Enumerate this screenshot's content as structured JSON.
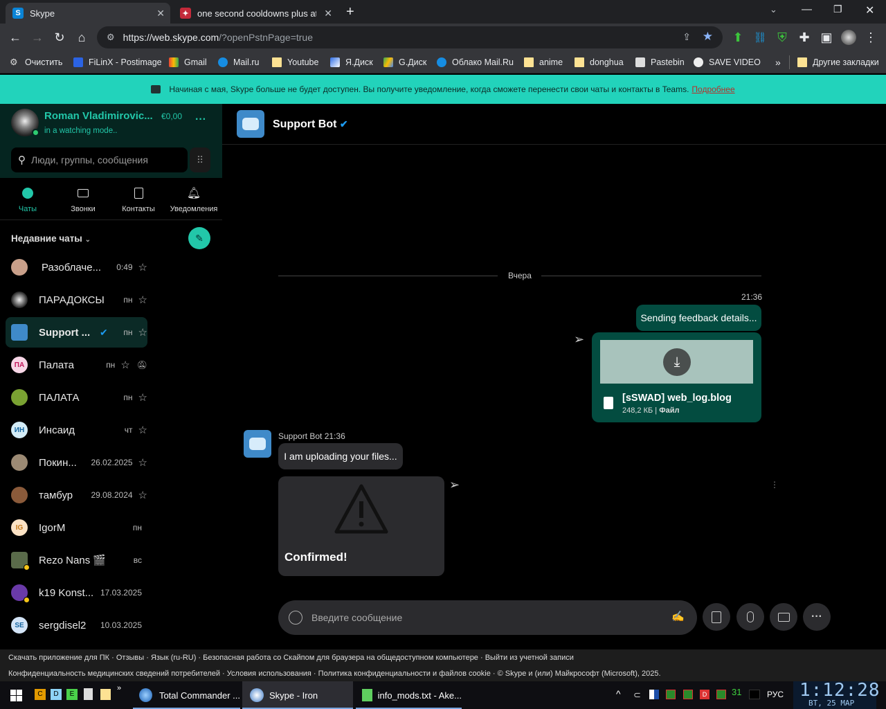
{
  "browser": {
    "tabs": [
      {
        "title": "Skype",
        "active": true
      },
      {
        "title": "one second cooldowns plus at D",
        "active": false
      }
    ],
    "new_tab_icon": "plus-icon",
    "url_host": "https://web.skype.com",
    "url_rest": "/?openPstnPage=true",
    "bookmarks": [
      {
        "label": "Очистить",
        "icon": "gear-icon"
      },
      {
        "label": "FiLinX - Postimage",
        "icon": "postimage-icon"
      },
      {
        "label": "Gmail",
        "icon": "gmail-icon"
      },
      {
        "label": "Mail.ru",
        "icon": "at-icon"
      },
      {
        "label": "Youtube",
        "icon": "folder-icon"
      },
      {
        "label": "Я.Диск",
        "icon": "yadisk-icon"
      },
      {
        "label": "G.Диск",
        "icon": "gdrive-icon"
      },
      {
        "label": "Облако Mail.Ru",
        "icon": "cloud-icon"
      },
      {
        "label": "anime",
        "icon": "folder-icon"
      },
      {
        "label": "donghua",
        "icon": "folder-icon"
      },
      {
        "label": "Pastebin",
        "icon": "pastebin-icon"
      },
      {
        "label": "SAVE VIDEO",
        "icon": "globe-icon"
      }
    ],
    "overflow": "»",
    "other_bookmarks": "Другие закладки"
  },
  "banner": {
    "text": "Начиная с мая, Skype больше не будет доступен. Вы получите уведомление, когда сможете перенести свои чаты и контакты в Teams.",
    "link": "Подробнее"
  },
  "profile": {
    "name": "Roman Vladimirovic...",
    "balance": "€0,00",
    "status": "in a watching mode..",
    "more": "···"
  },
  "search": {
    "placeholder": "Люди, группы, сообщения"
  },
  "nav": [
    {
      "label": "Чаты",
      "icon": "chat-icon"
    },
    {
      "label": "Звонки",
      "icon": "video-icon"
    },
    {
      "label": "Контакты",
      "icon": "contacts-icon"
    },
    {
      "label": "Уведомления",
      "icon": "bell-icon"
    }
  ],
  "recent_title": "Недавние чаты",
  "chats": [
    {
      "name": "Разоблаче...",
      "time": "0:49",
      "avatar": "photo",
      "color": "#c9a08a"
    },
    {
      "name": "ПАРАДОКСЫ",
      "time": "пн",
      "avatar": "spiral",
      "color": "#444"
    },
    {
      "name": "Support ...",
      "time": "пн",
      "avatar": "bot",
      "color": "#3f8ac9",
      "verified": true,
      "selected": true
    },
    {
      "name": "Палата",
      "time": "пн",
      "avatar": "ПА",
      "color": "#f7d6e6",
      "muted": true
    },
    {
      "name": "ПАЛАТА",
      "time": "пн",
      "avatar": "photo",
      "color": "#7aa232"
    },
    {
      "name": "Инсаид",
      "time": "чт",
      "avatar": "ИН",
      "color": "#d3ecf7"
    },
    {
      "name": "Покин...",
      "time": "26.02.2025",
      "avatar": "photo",
      "color": "#9c8a74"
    },
    {
      "name": "тамбур",
      "time": "29.08.2024",
      "avatar": "photo",
      "color": "#8a5a3a"
    },
    {
      "name": "IgorM",
      "time": "пн",
      "avatar": "IG",
      "color": "#fbe2c4"
    },
    {
      "name": "Rezo Nans 🎬",
      "time": "вс",
      "avatar": "photo",
      "color": "#5a6b4a",
      "away": true
    },
    {
      "name": "k19 Konst...",
      "time": "17.03.2025",
      "avatar": "photo",
      "color": "#6a3aa8",
      "away": true
    },
    {
      "name": "sergdisel2",
      "time": "10.03.2025",
      "avatar": "SE",
      "color": "#d3e4f7"
    }
  ],
  "conversation": {
    "title": "Support Bot",
    "date_divider": "Вчера",
    "out_time": "21:36",
    "out_text": "Sending feedback details...",
    "file_name": "[sSWAD] web_log.blog",
    "file_size": "248,2 КБ",
    "file_type": "Файл",
    "in_meta": "Support Bot 21:36",
    "in_text": "I am uploading your files...",
    "card_text": "Confirmed!",
    "composer_placeholder": "Введите сообщение"
  },
  "footer": {
    "row1": [
      "Скачать приложение для ПК",
      "Отзывы",
      "Язык (ru-RU)",
      "Безопасная работа со Скайпом для браузера на общедоступном компьютере",
      "Выйти из учетной записи"
    ],
    "row2": [
      "Конфиденциальность медицинских сведений потребителей",
      "Условия использования",
      "Политика конфиденциальности и файлов cookie",
      "© Skype и (или) Майкрософт (Microsoft), 2025."
    ]
  },
  "taskbar": {
    "apps": [
      {
        "label": "Total Commander ...",
        "active": false
      },
      {
        "label": "Skype - Iron",
        "active": true
      },
      {
        "label": "info_mods.txt - Ake...",
        "active": false
      }
    ],
    "lang": "РУС",
    "time": "1:12:28",
    "date": "ВТ, 25  МАР"
  }
}
